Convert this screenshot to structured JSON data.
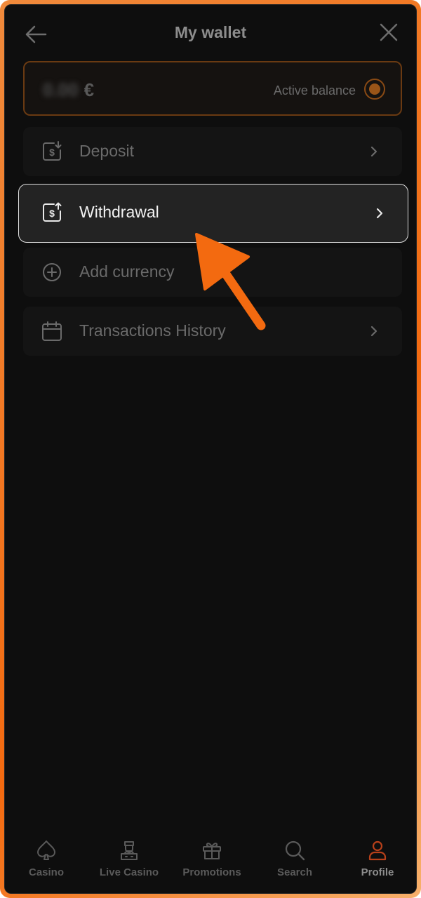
{
  "header": {
    "title": "My wallet",
    "back_icon": "arrow-left-icon",
    "close_icon": "close-icon"
  },
  "balance": {
    "amount": "0.00",
    "currency": "€",
    "label": "Active balance"
  },
  "menu": [
    {
      "label": "Deposit",
      "icon": "dollar-download-icon"
    },
    {
      "label": "Withdrawal",
      "icon": "dollar-upload-icon"
    },
    {
      "label": "Add currency",
      "icon": "plus-circle-icon"
    },
    {
      "label": "Transactions History",
      "icon": "calendar-icon"
    }
  ],
  "bottom_nav": [
    {
      "label": "Casino",
      "icon": "spade-icon"
    },
    {
      "label": "Live Casino",
      "icon": "dealer-icon"
    },
    {
      "label": "Promotions",
      "icon": "gift-icon"
    },
    {
      "label": "Search",
      "icon": "search-icon"
    },
    {
      "label": "Profile",
      "icon": "user-icon"
    }
  ],
  "colors": {
    "accent": "#f36a10",
    "background": "#0e0e0e",
    "profile_active": "#b8401a"
  }
}
